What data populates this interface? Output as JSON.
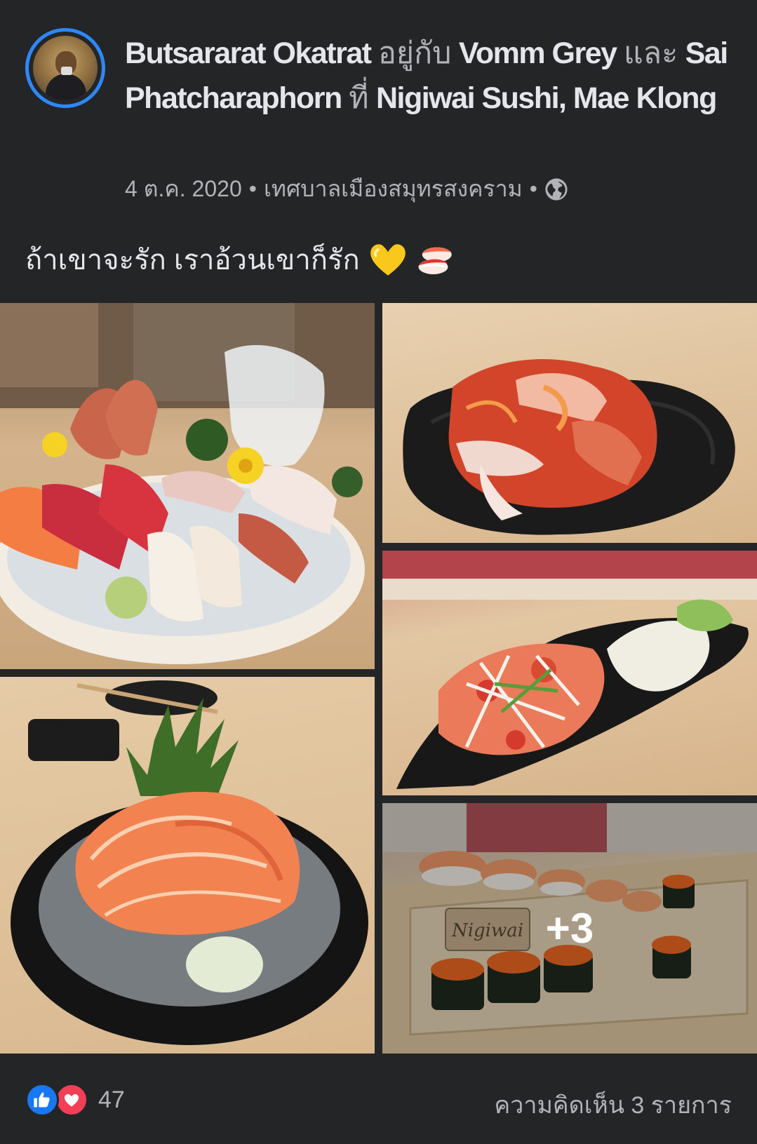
{
  "post": {
    "author": "Butsararat Okatrat",
    "with_word": "อยู่กับ",
    "friend1": "Vomm Grey",
    "and_word": "และ",
    "friend2": "Sai Phatcharaphorn",
    "at_word": "ที่",
    "place": "Nigiwai Sushi, Mae Klong",
    "date": "4 ต.ค. 2020",
    "separator": "•",
    "location": "เทศบาลเมืองสมุทรสงคราม",
    "privacy_icon": "globe-icon",
    "caption": "ถ้าเขาจะรัก เราอ้วนเขาก็รัก",
    "caption_emojis": [
      "yellow-heart-icon",
      "sushi-icon"
    ]
  },
  "photos": [
    {
      "name": "sashimi-platter-photo"
    },
    {
      "name": "kimchi-photo"
    },
    {
      "name": "salmon-salad-photo"
    },
    {
      "name": "salmon-sashimi-photo"
    },
    {
      "name": "sushi-board-photo"
    }
  ],
  "more_photos_label": "+3",
  "watermark": "Nigiwai",
  "footer": {
    "reaction_icons": [
      "like-icon",
      "love-icon"
    ],
    "reaction_count": "47",
    "comments_label": "ความคิดเห็น 3 รายการ"
  },
  "colors": {
    "background": "#242526",
    "primary_text": "#e4e6eb",
    "secondary_text": "#b0b3b8",
    "story_ring": "#2d88ff",
    "like_blue": "#1877f2",
    "love_red": "#f33e58"
  }
}
